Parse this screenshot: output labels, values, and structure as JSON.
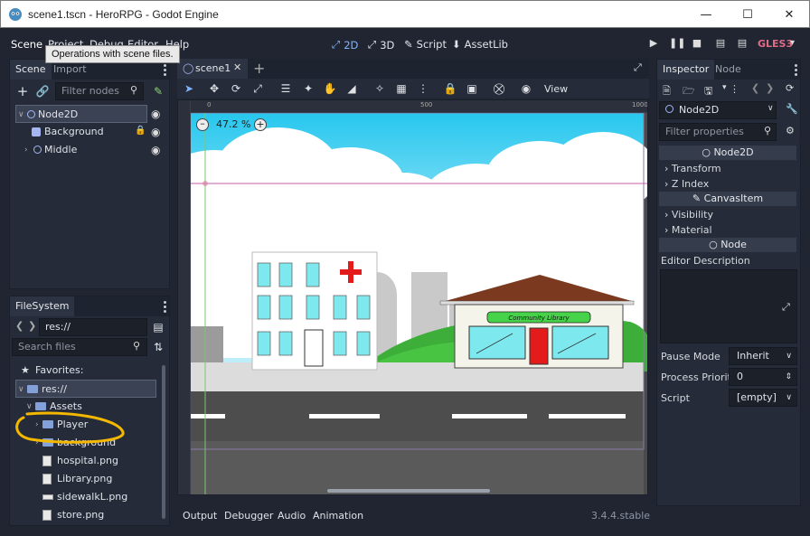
{
  "window": {
    "title": "scene1.tscn - HeroRPG - Godot Engine"
  },
  "menu": [
    "Scene",
    "Project",
    "Debug",
    "Editor",
    "Help"
  ],
  "tooltip": "Operations with scene files.",
  "workspaces": [
    "2D",
    "3D",
    "Script",
    "AssetLib"
  ],
  "renderer": "GLES3",
  "scene_dock": {
    "tabs": [
      "Scene",
      "Import"
    ],
    "filter_placeholder": "Filter nodes",
    "nodes": [
      {
        "name": "Node2D"
      },
      {
        "name": "Background"
      },
      {
        "name": "Middle"
      }
    ]
  },
  "filesystem": {
    "tab": "FileSystem",
    "path": "res://",
    "search_placeholder": "Search files",
    "favorites_label": "Favorites:",
    "root": "res://",
    "items": [
      "Assets",
      "Player",
      "background",
      "hospital.png",
      "Library.png",
      "sidewalkL.png",
      "store.png"
    ]
  },
  "editor": {
    "tab": "scene1",
    "zoom": "47.2 %",
    "view_label": "View",
    "ruler_marks": [
      "0",
      "500",
      "1000"
    ],
    "store_sign": "Community Library"
  },
  "bottom_panel": {
    "tabs": [
      "Output",
      "Debugger",
      "Audio",
      "Animation"
    ],
    "version": "3.4.4.stable"
  },
  "inspector": {
    "tabs": [
      "Inspector",
      "Node"
    ],
    "object": "Node2D",
    "filter_placeholder": "Filter properties",
    "sections": {
      "node2d": "Node2D",
      "transform": "Transform",
      "zindex": "Z Index",
      "canvasitem": "CanvasItem",
      "visibility": "Visibility",
      "material": "Material",
      "node": "Node",
      "editor_description": "Editor Description"
    },
    "props": {
      "pause_label": "Pause Mode",
      "pause_value": "Inherit",
      "priority_label": "Process Priorit",
      "priority_value": "0",
      "script_label": "Script",
      "script_value": "[empty]"
    }
  },
  "colors": {
    "accent": "#7fb5ff",
    "gles": "#e16b86",
    "annotation": "#f5b800"
  }
}
